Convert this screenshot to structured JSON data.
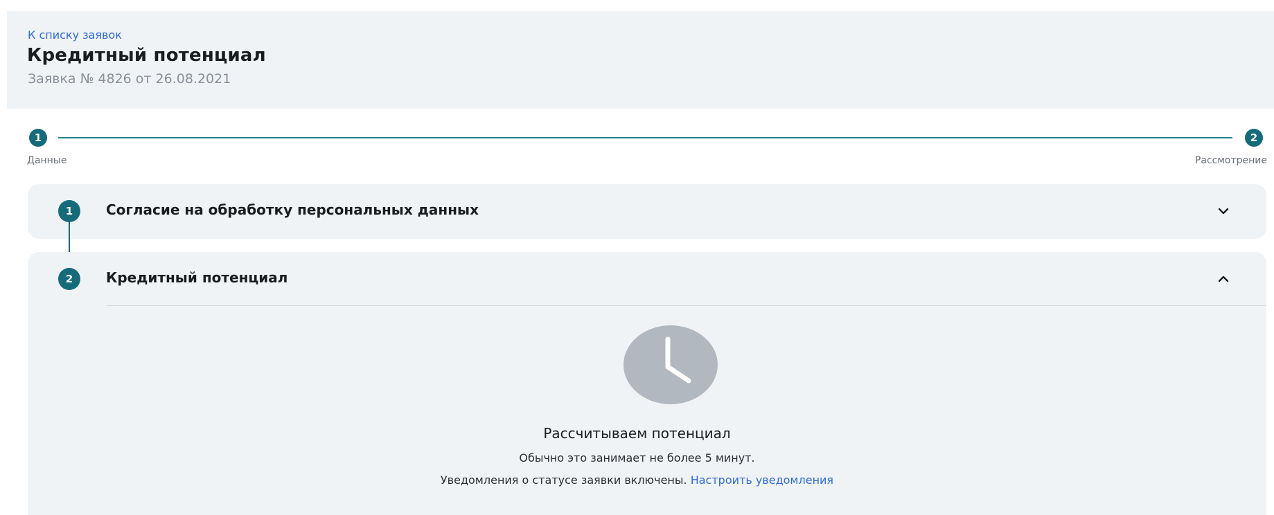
{
  "header": {
    "back_link": "К списку заявок",
    "title": "Кредитный потенциал",
    "subtitle": "Заявка № 4826 от 26.08.2021"
  },
  "stepper": {
    "steps": [
      {
        "number": "1",
        "label": "Данные"
      },
      {
        "number": "2",
        "label": "Рассмотрение"
      }
    ],
    "accent_color": "#156b7a"
  },
  "sections": [
    {
      "number": "1",
      "title": "Согласие на обработку персональных данных",
      "expanded": false,
      "chevron_icon": "chevron-down-icon"
    },
    {
      "number": "2",
      "title": "Кредитный потенциал",
      "expanded": true,
      "chevron_icon": "chevron-up-icon"
    }
  ],
  "status": {
    "icon": "clock-icon",
    "title": "Рассчитываем потенциал",
    "note": "Обычно это занимает не более 5 минут.",
    "notifications_text": "Уведомления о статусе заявки включены.",
    "notifications_link": "Настроить уведомления"
  },
  "colors": {
    "link": "#2f6bd8",
    "panel_bg": "#f0f3f6",
    "clock_bg": "#b2b8c0"
  }
}
